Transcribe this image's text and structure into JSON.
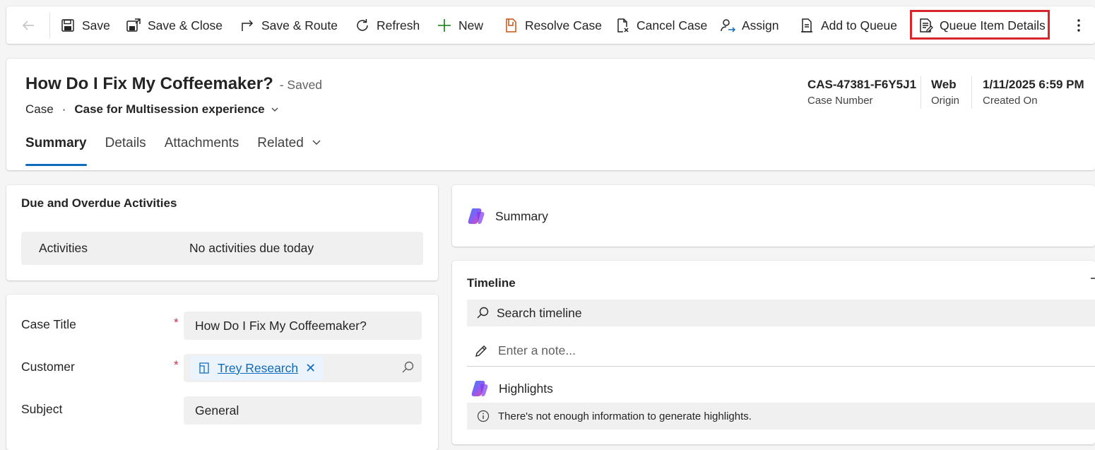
{
  "command_bar": {
    "save": "Save",
    "save_close": "Save & Close",
    "save_route": "Save & Route",
    "refresh": "Refresh",
    "new": "New",
    "resolve_case": "Resolve Case",
    "cancel_case": "Cancel Case",
    "assign": "Assign",
    "add_to_queue": "Add to Queue",
    "queue_item_details": "Queue Item Details",
    "highlight_color": "#d9262c"
  },
  "header": {
    "title": "How Do I Fix My Coffeemaker?",
    "saved_status": "- Saved",
    "entity": "Case",
    "dot": "·",
    "form_name": "Case for Multisession experience",
    "fields": [
      {
        "value": "CAS-47381-F6Y5J1",
        "label": "Case Number"
      },
      {
        "value": "Web",
        "label": "Origin"
      },
      {
        "value": "1/11/2025 6:59 PM",
        "label": "Created On"
      }
    ],
    "tabs": [
      "Summary",
      "Details",
      "Attachments",
      "Related"
    ]
  },
  "activities": {
    "title": "Due and Overdue Activities",
    "label": "Activities",
    "value": "No activities due today"
  },
  "form": {
    "case_title_label": "Case Title",
    "case_title_value": "How Do I Fix My Coffeemaker?",
    "customer_label": "Customer",
    "customer_value": "Trey Research",
    "subject_label": "Subject",
    "subject_value": "General",
    "required_mark": "*"
  },
  "summary_card": {
    "label": "Summary"
  },
  "timeline": {
    "title": "Timeline",
    "search_placeholder": "Search timeline",
    "note_placeholder": "Enter a note...",
    "highlights_label": "Highlights",
    "highlights_info": "There's not enough information to generate highlights."
  },
  "colors": {
    "accent": "#0f6cbd",
    "required": "#c4314b"
  }
}
